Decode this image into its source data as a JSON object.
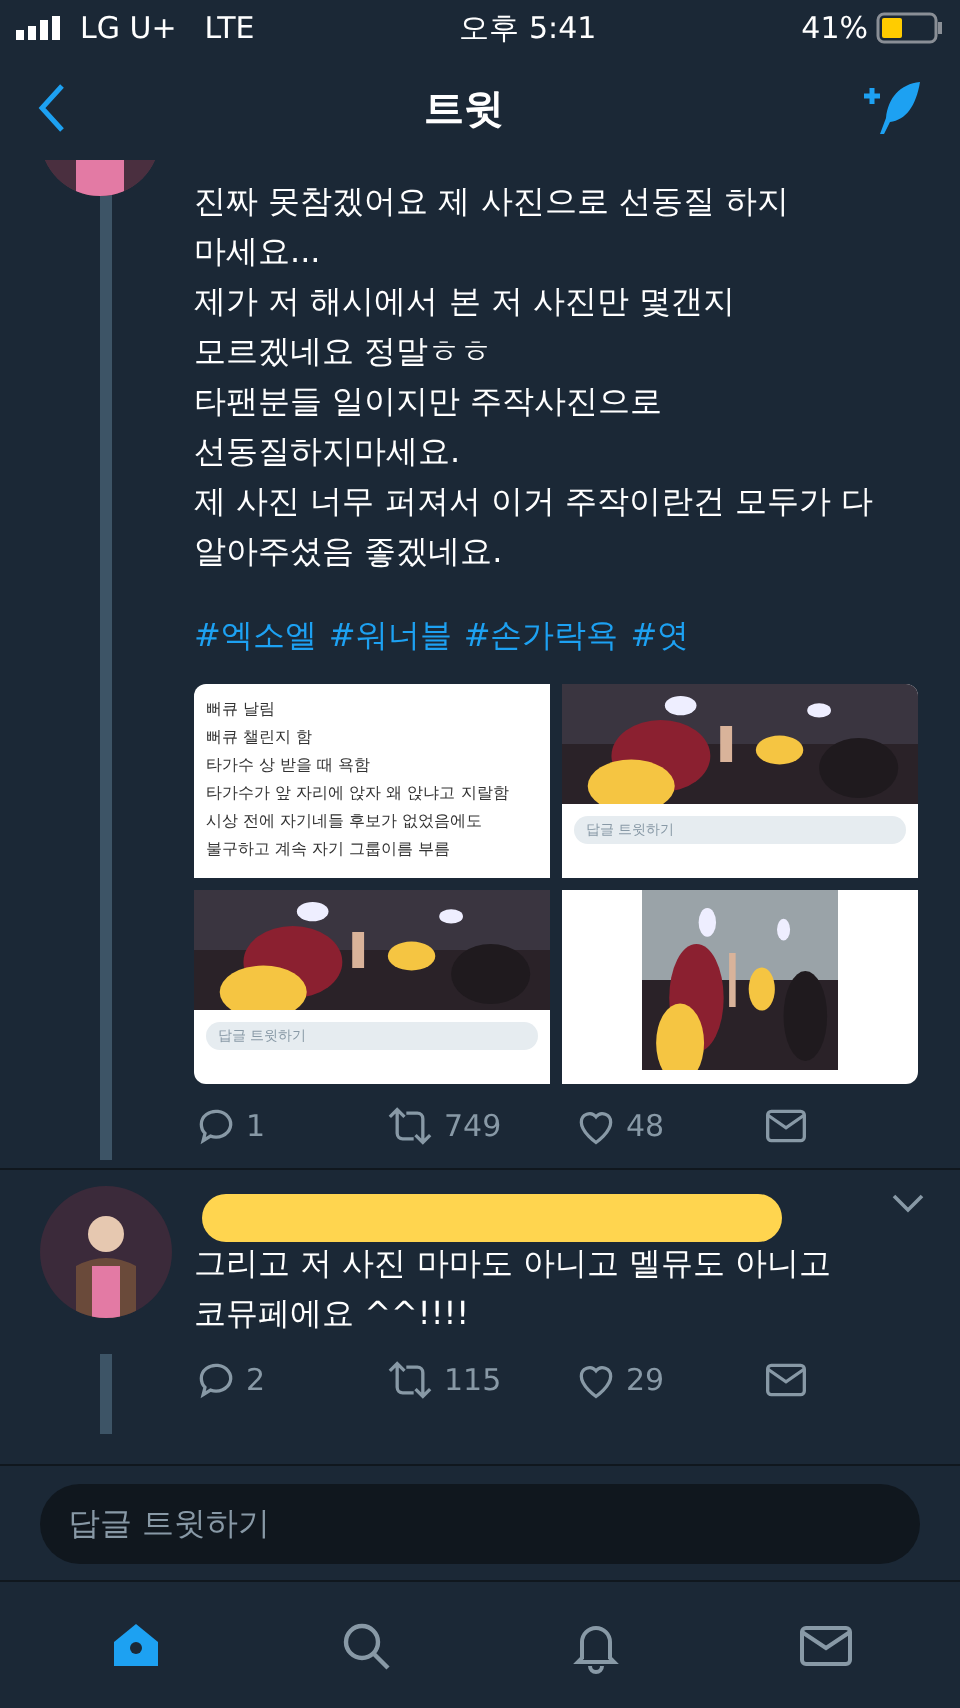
{
  "status_bar": {
    "carrier": "LG U+",
    "network": "LTE",
    "time": "오후 5:41",
    "battery": "41%"
  },
  "nav": {
    "title": "트윗"
  },
  "tweet": {
    "text_lines": [
      "진짜 못참겠어요 제 사진으로 선동질 하지",
      "마세요...",
      "제가 저 해시에서 본 저 사진만 몇갠지",
      "모르겠네요 정말ㅎㅎ",
      "타팬분들 일이지만 주작사진으로",
      "선동질하지마세요.",
      "제 사진 너무 퍼져서 이거 주작이란건 모두가 다",
      "알아주셨음 좋겠네요."
    ],
    "hashtags": [
      "#엑소엘",
      "#워너블",
      "#손가락욕",
      "#엿"
    ],
    "media": [
      {
        "kind": "text",
        "lines": [
          "뻐큐 날림",
          "뻐큐 챌린지 함",
          "타가수 상 받을 때 욕함",
          "타가수가 앞 자리에 앉자 왜 앉냐고 지랄함",
          "시상 전에 자기네들 후보가 없었음에도",
          "불구하고 계속 자기 그룹이름 부름"
        ]
      },
      {
        "reply_hint": "답글 트윗하기"
      },
      {
        "reply_hint": "답글 트윗하기"
      },
      {
        "kind": "photo_tall"
      }
    ],
    "actions": {
      "replies": "1",
      "retweets": "749",
      "likes": "48"
    }
  },
  "reply": {
    "text_lines": [
      "그리고 저 사진 마마도 아니고 멜뮤도 아니고",
      "코뮤페에요 ^^!!!!"
    ],
    "actions": {
      "replies": "2",
      "retweets": "115",
      "likes": "29"
    }
  },
  "composer": {
    "placeholder": "답글 트윗하기"
  },
  "tab_bar": [
    {
      "kind": "home",
      "selected": true
    },
    {
      "kind": "search",
      "selected": false
    },
    {
      "kind": "notifications",
      "selected": false
    },
    {
      "kind": "messages",
      "selected": false
    }
  ]
}
